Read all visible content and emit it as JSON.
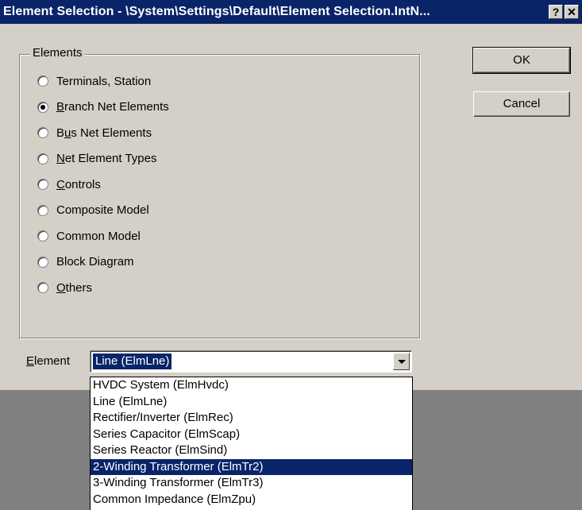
{
  "window": {
    "title": "Element Selection - \\System\\Settings\\Default\\Element Selection.IntN...",
    "help_button": "?",
    "close_button": "✕"
  },
  "elements_group": {
    "title": "Elements",
    "options": [
      {
        "label": "Terminals, Station",
        "mnemonic": "",
        "checked": false
      },
      {
        "label": "Branch Net Elements",
        "mnemonic": "B",
        "checked": true
      },
      {
        "label": "Bus Net Elements",
        "mnemonic": "u",
        "checked": false
      },
      {
        "label": "Net Element Types",
        "mnemonic": "N",
        "checked": false
      },
      {
        "label": "Controls",
        "mnemonic": "C",
        "checked": false
      },
      {
        "label": "Composite Model",
        "mnemonic": "",
        "checked": false
      },
      {
        "label": "Common Model",
        "mnemonic": "",
        "checked": false
      },
      {
        "label": "Block Diagram",
        "mnemonic": "",
        "checked": false
      },
      {
        "label": "Others",
        "mnemonic": "O",
        "checked": false
      }
    ]
  },
  "buttons": {
    "ok": "OK",
    "cancel": "Cancel"
  },
  "element_field": {
    "label": "Element",
    "value": "Line (ElmLne)",
    "options": [
      "HVDC System (ElmHvdc)",
      "Line (ElmLne)",
      "Rectifier/Inverter (ElmRec)",
      "Series Capacitor (ElmScap)",
      "Series Reactor (ElmSind)",
      "2-Winding Transformer (ElmTr2)",
      "3-Winding Transformer (ElmTr3)",
      "Common Impedance (ElmZpu)"
    ],
    "highlighted_index": 5
  }
}
